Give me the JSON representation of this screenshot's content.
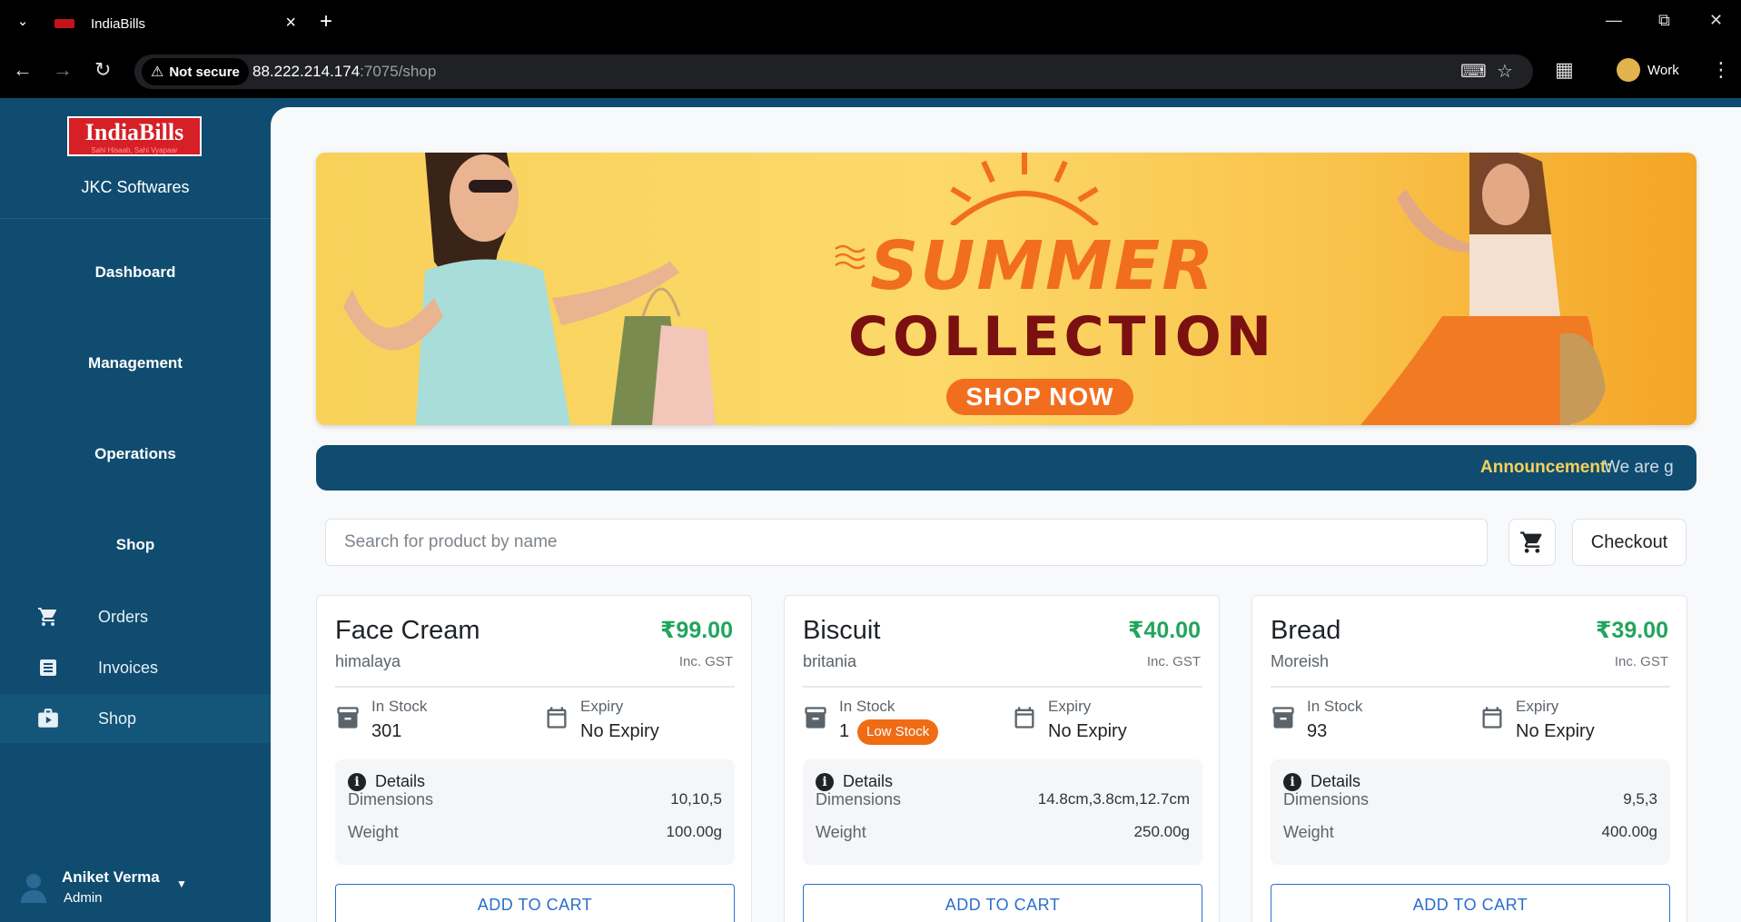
{
  "browser": {
    "tab_title": "IndiaBills",
    "security_label": "Not secure",
    "url_host": "88.222.214.174",
    "url_path": ":7075/shop",
    "profile_name": "Work"
  },
  "sidebar": {
    "logo_text": "IndiaBills",
    "logo_tagline": "Sahi Hisaab, Sahi Vyapaar",
    "company": "JKC Softwares",
    "sections": [
      "Dashboard",
      "Management",
      "Operations",
      "Shop"
    ],
    "items": [
      {
        "label": "Orders",
        "icon": "cart-icon"
      },
      {
        "label": "Invoices",
        "icon": "list-icon"
      },
      {
        "label": "Shop",
        "icon": "briefcase-icon"
      }
    ],
    "user": {
      "name": "Aniket Verma",
      "role": "Admin"
    }
  },
  "banner": {
    "title_line1": "SUMMER",
    "title_line2": "COLLECTION",
    "button": "SHOP NOW"
  },
  "announcement": {
    "label": "Announcement:",
    "text": "We are g"
  },
  "search": {
    "placeholder": "Search for product by name"
  },
  "checkout_label": "Checkout",
  "products": [
    {
      "name": "Face Cream",
      "price": "₹99.00",
      "brand": "himalaya",
      "tax_note": "Inc. GST",
      "stock_label": "In Stock",
      "stock_value": "301",
      "expiry_label": "Expiry",
      "expiry_value": "No Expiry",
      "details_label": "Details",
      "dimensions_label": "Dimensions",
      "dimensions": "10,10,5",
      "weight_label": "Weight",
      "weight": "100.00g",
      "add_label": "ADD TO CART"
    },
    {
      "name": "Biscuit",
      "price": "₹40.00",
      "brand": "britania",
      "tax_note": "Inc. GST",
      "stock_label": "In Stock",
      "stock_value": "1",
      "badge": "Low Stock",
      "expiry_label": "Expiry",
      "expiry_value": "No Expiry",
      "details_label": "Details",
      "dimensions_label": "Dimensions",
      "dimensions": "14.8cm,3.8cm,12.7cm",
      "weight_label": "Weight",
      "weight": "250.00g",
      "add_label": "ADD TO CART"
    },
    {
      "name": "Bread",
      "price": "₹39.00",
      "brand": "Moreish",
      "tax_note": "Inc. GST",
      "stock_label": "In Stock",
      "stock_value": "93",
      "expiry_label": "Expiry",
      "expiry_value": "No Expiry",
      "details_label": "Details",
      "dimensions_label": "Dimensions",
      "dimensions": "9,5,3",
      "weight_label": "Weight",
      "weight": "400.00g",
      "add_label": "ADD TO CART"
    }
  ],
  "colors": {
    "sidebar": "#0f4c70",
    "price": "#22a55d",
    "low_stock": "#ef6c15",
    "add_button": "#2a6fc9",
    "banner_orange": "#f26e1f",
    "banner_maroon": "#7b1010"
  }
}
